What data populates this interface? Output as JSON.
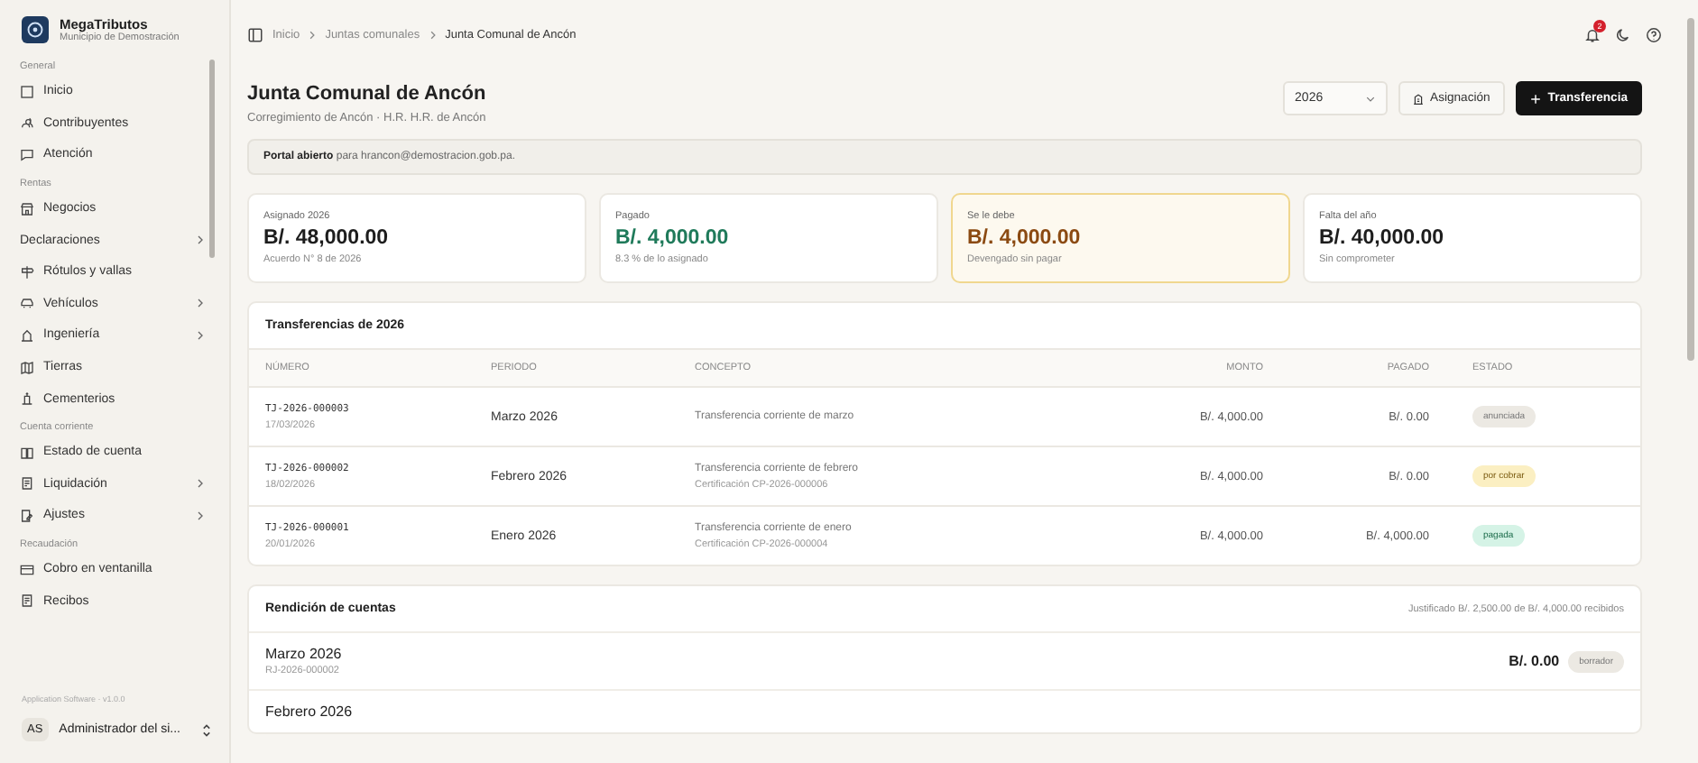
{
  "brand": {
    "name": "MegaTributos",
    "subtitle": "Municipio de Demostración"
  },
  "sidebar": {
    "sections": [
      {
        "title": "General",
        "items": [
          {
            "label": "Inicio",
            "expandable": false
          },
          {
            "label": "Contribuyentes",
            "expandable": false
          },
          {
            "label": "Atención",
            "expandable": false
          }
        ]
      },
      {
        "title": "Rentas",
        "items": [
          {
            "label": "Negocios",
            "expandable": false
          },
          {
            "label": "Declaraciones",
            "expandable": true
          },
          {
            "label": "Rótulos y vallas",
            "expandable": false
          },
          {
            "label": "Vehículos",
            "expandable": true
          },
          {
            "label": "Ingeniería",
            "expandable": true
          },
          {
            "label": "Tierras",
            "expandable": false
          },
          {
            "label": "Cementerios",
            "expandable": false
          }
        ]
      },
      {
        "title": "Cuenta corriente",
        "items": [
          {
            "label": "Estado de cuenta",
            "expandable": false
          },
          {
            "label": "Liquidación",
            "expandable": true
          },
          {
            "label": "Ajustes",
            "expandable": true
          }
        ]
      },
      {
        "title": "Recaudación",
        "items": [
          {
            "label": "Cobro en ventanilla",
            "expandable": false
          },
          {
            "label": "Recibos",
            "expandable": false
          }
        ]
      }
    ],
    "version": "Application Software · v1.0.0",
    "user": {
      "initials": "AS",
      "name": "Administrador del si..."
    }
  },
  "breadcrumb": [
    "Inicio",
    "Juntas comunales",
    "Junta Comunal de Ancón"
  ],
  "notifications": {
    "count": "2"
  },
  "header": {
    "title": "Junta Comunal de Ancón",
    "subtitle": "Corregimiento de Ancón · H.R. H.R. de Ancón",
    "year": "2026",
    "buttons": [
      {
        "label": "Asignación",
        "kind": "secondary"
      },
      {
        "label": "Transferencia",
        "kind": "primary"
      }
    ]
  },
  "notice": {
    "text": "**Portal abierto** para hrancon@demostracion.gob.pa."
  },
  "stats": [
    {
      "label": "Asignado 2026",
      "value": "B/. 48,000.00",
      "note": "Acuerdo N° 8 de 2026",
      "kind": "neutral"
    },
    {
      "label": "Pagado",
      "value": "B/. 4,000.00",
      "note": "8.3 % de lo asignado",
      "kind": "positive"
    },
    {
      "label": "Se le debe",
      "value": "B/. 4,000.00",
      "note": "Devengado sin pagar",
      "kind": "warning"
    },
    {
      "label": "Falta del año",
      "value": "B/. 40,000.00",
      "note": "Sin comprometer",
      "kind": "neutral"
    }
  ],
  "transfers": {
    "title": "Transferencias de 2026",
    "columns": [
      "NÚMERO",
      "PERIODO",
      "CONCEPTO",
      "MONTO",
      "PAGADO",
      "ESTADO"
    ],
    "rows": [
      {
        "number": "TJ-2026-000003",
        "date": "17/03/2026",
        "period": "Marzo 2026",
        "concept": "Transferencia corriente de marzo",
        "amount": "B/. 4,000.00",
        "paid": "B/. 0.00",
        "status": "anunciada",
        "kind": "neutral"
      },
      {
        "number": "TJ-2026-000002",
        "date": "18/02/2026",
        "period": "Febrero 2026",
        "concept": "Transferencia corriente de febrero",
        "certification": "Certificación CP-2026-000006",
        "amount": "B/. 4,000.00",
        "paid": "B/. 0.00",
        "status": "por cobrar",
        "kind": "warning"
      },
      {
        "number": "TJ-2026-000001",
        "date": "20/01/2026",
        "period": "Enero 2026",
        "concept": "Transferencia corriente de enero",
        "certification": "Certificación CP-2026-000004",
        "amount": "B/. 4,000.00",
        "paid": "B/. 4,000.00",
        "status": "pagada",
        "kind": "positive"
      }
    ]
  },
  "rendicion": {
    "title": "Rendición de cuentas",
    "summary": "Justificado B/. 2,500.00 de B/. 4,000.00 recibidos",
    "items": [
      {
        "period": "Marzo 2026",
        "code": "RJ-2026-000002",
        "amount": "B/. 0.00",
        "status": "borrador",
        "kind": "neutral"
      },
      {
        "period": "Febrero 2026"
      }
    ]
  }
}
